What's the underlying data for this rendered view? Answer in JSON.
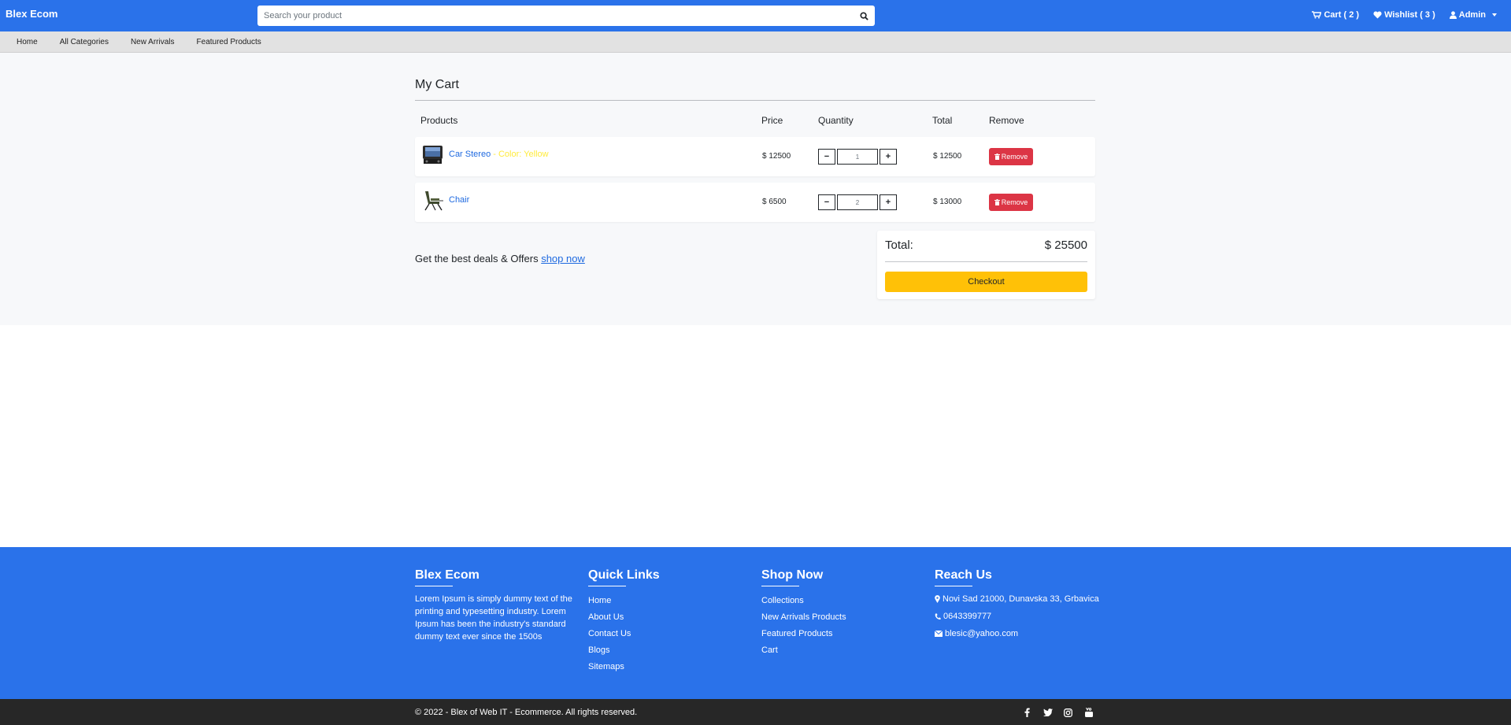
{
  "navbar": {
    "brand": "Blex Ecom",
    "search": {
      "placeholder": "Search your product"
    },
    "cart_label": "Cart ( 2 )",
    "wishlist_label": "Wishlist ( 3 )",
    "admin_label": "Admin",
    "brand_color": "#2a72ea"
  },
  "subnav": {
    "items": [
      {
        "label": "Home"
      },
      {
        "label": "All Categories"
      },
      {
        "label": "New Arrivals"
      },
      {
        "label": "Featured Products"
      }
    ]
  },
  "cart": {
    "title": "My Cart",
    "headers": {
      "products": "Products",
      "price": "Price",
      "quantity": "Quantity",
      "total": "Total",
      "remove": "Remove"
    },
    "items": [
      {
        "name": "Car Stereo",
        "color": "- Color: Yellow",
        "price": "$ 12500",
        "quantity": "1",
        "total": "$ 12500",
        "remove_label": "Remove",
        "thumb_icon": "car-stereo-image"
      },
      {
        "name": "Chair",
        "color": "",
        "price": "$ 6500",
        "quantity": "2",
        "total": "$ 13000",
        "remove_label": "Remove",
        "thumb_icon": "chair-image"
      }
    ],
    "deals_text": "Get the best deals & Offers",
    "deals_link": "shop now",
    "summary": {
      "label": "Total:",
      "value": "$ 25500",
      "checkout_label": "Checkout"
    },
    "qty_minus": "−",
    "qty_plus": "+"
  },
  "footer": {
    "about": {
      "heading": "Blex Ecom",
      "text": "Lorem Ipsum is simply dummy text of the printing and typesetting industry. Lorem Ipsum has been the industry's standard dummy text ever since the 1500s"
    },
    "quick_links": {
      "heading": "Quick Links",
      "links": [
        "Home",
        "About Us",
        "Contact Us",
        "Blogs",
        "Sitemaps"
      ]
    },
    "shop_now": {
      "heading": "Shop Now",
      "links": [
        "Collections",
        "New Arrivals Products",
        "Featured Products",
        "Cart"
      ]
    },
    "reach_us": {
      "heading": "Reach Us",
      "address": "Novi Sad 21000, Dunavska 33, Grbavica",
      "phone": "0643399777",
      "email": "blesic@yahoo.com"
    },
    "copyright": "© 2022 - Blex of Web IT - Ecommerce. All rights reserved.",
    "socials": [
      "facebook-icon",
      "twitter-icon",
      "instagram-icon",
      "youtube-icon"
    ]
  }
}
